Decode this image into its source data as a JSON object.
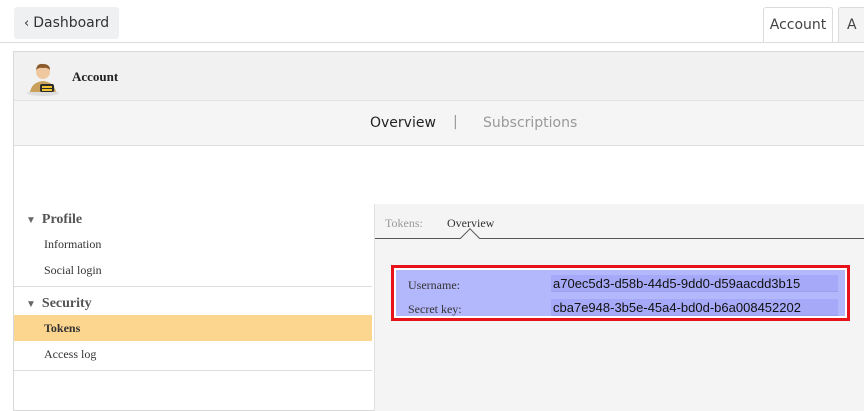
{
  "topbar": {
    "back_label": "Dashboard",
    "tabs": [
      {
        "label": "Account"
      },
      {
        "label": "A"
      }
    ]
  },
  "account_header": {
    "title": "Account"
  },
  "subnav": {
    "items": [
      {
        "label": "Overview"
      },
      {
        "label": "|"
      },
      {
        "label": "Subscriptions"
      }
    ]
  },
  "sidebar": {
    "sections": [
      {
        "title": "Profile",
        "items": [
          {
            "label": "Information"
          },
          {
            "label": "Social login"
          }
        ]
      },
      {
        "title": "Security",
        "items": [
          {
            "label": "Tokens"
          },
          {
            "label": "Access log"
          }
        ]
      }
    ]
  },
  "detail": {
    "tab_label": "Tokens:",
    "active_tab": "Overview",
    "username_label": "Username:",
    "username_value": "a70ec5d3-d58b-44d5-9dd0-d59aacdd3b15",
    "secret_label": "Secret key:",
    "secret_value": "cba7e948-3b5e-45a4-bd0d-b6a008452202"
  },
  "colors": {
    "active_item": "#fcd58f",
    "highlight_border": "#e8121b",
    "selection": "#b3b7fb"
  }
}
